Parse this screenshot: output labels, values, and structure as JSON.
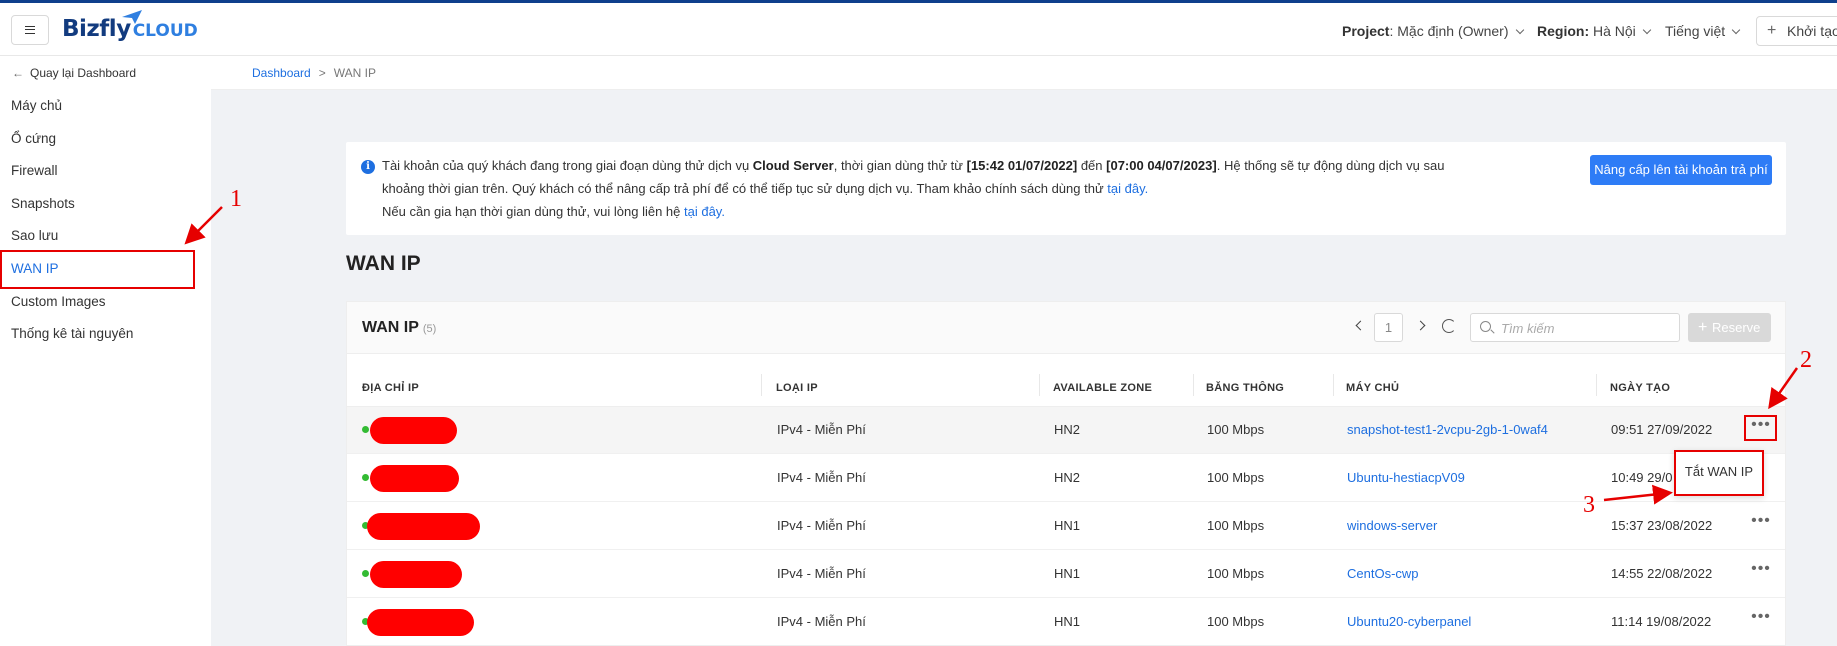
{
  "header": {
    "logo_main": "Bizfly",
    "logo_sub": "CLOUD",
    "project_label": "Project",
    "project_value": ": Mặc định (Owner)",
    "region_label": "Region:",
    "region_value": "Hà Nội",
    "language": "Tiếng việt",
    "create_label": "Khởi tạo"
  },
  "sidebar": {
    "back_label": "Quay lại Dashboard",
    "items": [
      {
        "label": "Máy chủ"
      },
      {
        "label": "Ổ cứng"
      },
      {
        "label": "Firewall"
      },
      {
        "label": "Snapshots"
      },
      {
        "label": "Sao lưu"
      },
      {
        "label": "WAN IP",
        "active": true
      },
      {
        "label": "Custom Images"
      },
      {
        "label": "Thống kê tài nguyên"
      }
    ]
  },
  "breadcrumb": {
    "root": "Dashboard",
    "sep": ">",
    "current": "WAN IP"
  },
  "notice": {
    "l1_a": "Tài khoản của quý khách đang trong giai đoạn dùng thử dịch vụ ",
    "l1_b": "Cloud Server",
    "l1_c": ", thời gian dùng thử từ ",
    "l1_d": "[15:42 01/07/2022]",
    "l1_e": " đến ",
    "l1_f": "[07:00 04/07/2023]",
    "l1_g": ". Hệ thống sẽ tự động dùng dịch vụ sau",
    "l2_a": "khoảng thời gian trên. Quý khách có thể nâng cấp trả phí để có thể tiếp tục sử dụng dịch vụ. Tham khảo chính sách dùng thử ",
    "l2_link": "tại đây.",
    "l3_a": "Nếu cần gia hạn thời gian dùng thử, vui lòng liên hệ ",
    "l3_link": "tại đây.",
    "upgrade_button": "Nâng cấp lên tài khoản trả phí"
  },
  "page_title": "WAN IP",
  "card": {
    "title": "WAN IP",
    "count": "(5)",
    "page": "1",
    "search_placeholder": "Tìm kiếm",
    "reserve_label": "Reserve",
    "columns": [
      "ĐỊA CHỈ IP",
      "LOẠI IP",
      "AVAILABLE ZONE",
      "BĂNG THÔNG",
      "MÁY CHỦ",
      "NGÀY TẠO"
    ],
    "rows": [
      {
        "type": "IPv4 - Miễn Phí",
        "zone": "HN2",
        "bandwidth": "100 Mbps",
        "server": "snapshot-test1-2vcpu-2gb-1-0waf4",
        "created": "09:51 27/09/2022"
      },
      {
        "type": "IPv4 - Miễn Phí",
        "zone": "HN2",
        "bandwidth": "100 Mbps",
        "server": "Ubuntu-hestiacpV09",
        "created": "10:49 29/0"
      },
      {
        "type": "IPv4 - Miễn Phí",
        "zone": "HN1",
        "bandwidth": "100 Mbps",
        "server": "windows-server",
        "created": "15:37 23/08/2022"
      },
      {
        "type": "IPv4 - Miễn Phí",
        "zone": "HN1",
        "bandwidth": "100 Mbps",
        "server": "CentOs-cwp",
        "created": "14:55 22/08/2022"
      },
      {
        "type": "IPv4 - Miễn Phí",
        "zone": "HN1",
        "bandwidth": "100 Mbps",
        "server": "Ubuntu20-cyberpanel",
        "created": "11:14 19/08/2022"
      }
    ],
    "more_glyph": "•••"
  },
  "popup": {
    "label": "Tắt WAN IP"
  },
  "annotations": {
    "n1": "1",
    "n2": "2",
    "n3": "3"
  },
  "colors": {
    "accent": "#1e6fe0",
    "annotation": "#e60000",
    "status_dot": "#33bb33"
  }
}
